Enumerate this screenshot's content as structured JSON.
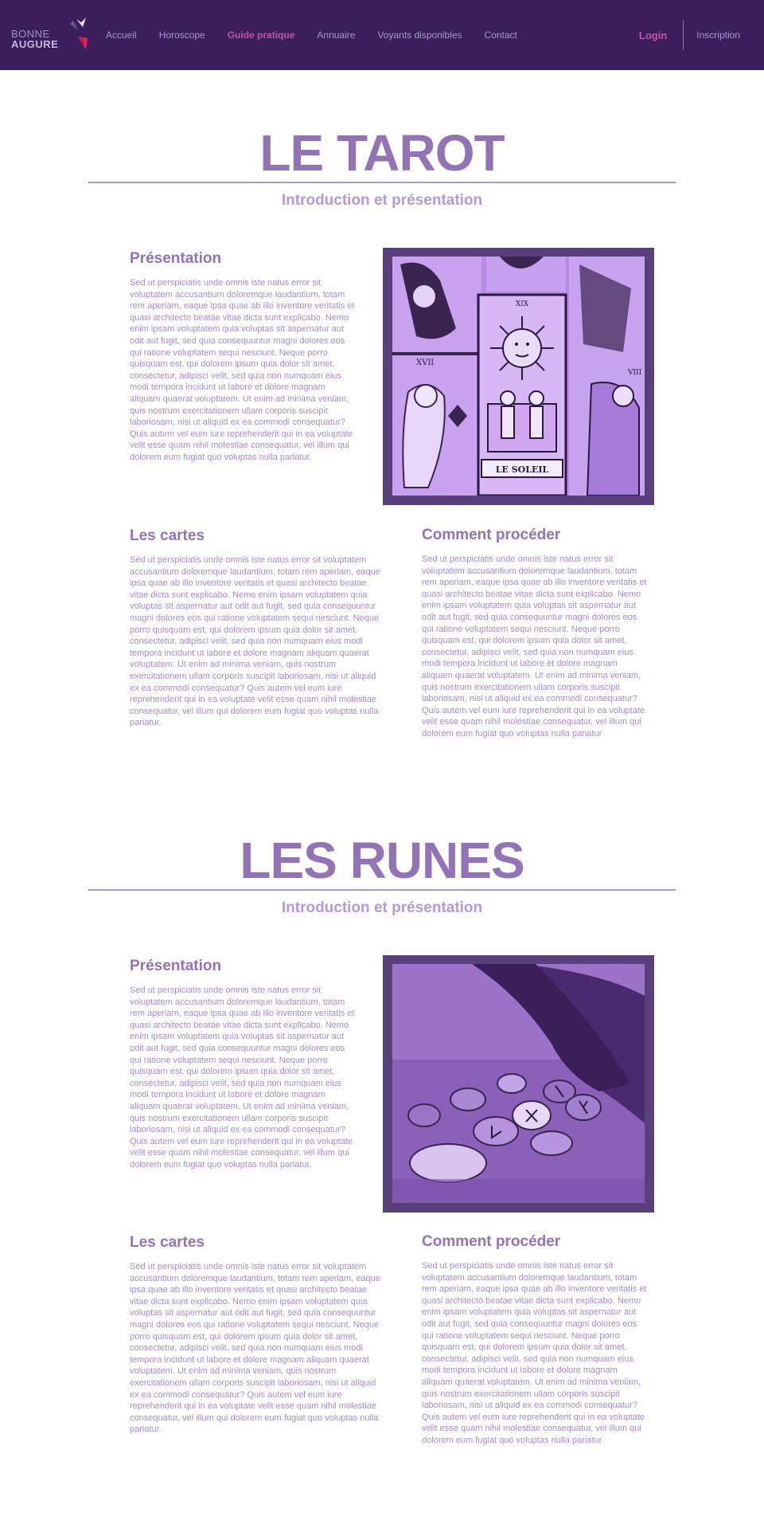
{
  "logo": {
    "line1": "BONNE",
    "line2": "AUGURE"
  },
  "nav": {
    "items": [
      "Accueil",
      "Horoscope",
      "Guide pratique",
      "Annuaire",
      "Voyants disponibles",
      "Contact"
    ],
    "active": "Guide pratique"
  },
  "auth": {
    "login": "Login",
    "signup": "Inscription"
  },
  "sections": [
    {
      "title": "LE TAROT",
      "subtitle": "Introduction et présentation",
      "presentation": {
        "heading": "Présentation",
        "text": "Sed ut perspiciatis unde omnis iste natus error sit voluptatem accusantium doloremque laudantium, totam rem aperiam, eaque ipsa quae ab illo inventore veritatis et quasi architecto beatae vitae dicta sunt explicabo. Nemo enim ipsam voluptatem quia voluptas sit aspernatur aut odit aut fugit, sed quia consequuntur magni dolores eos qui ratione voluptatem sequi nesciunt. Neque porro quisquam est, qui dolorem ipsum quia dolor sit amet, consectetur, adipisci velit, sed quia non numquam eius modi tempora incidunt ut labore et dolore magnam aliquam quaerat voluptatem. Ut enim ad minima veniam, quis nostrum exercitationem ullam corporis suscipit laboriosam, nisi ut aliquid ex ea commodi consequatur? Quis autem vel eum iure reprehenderit qui in ea voluptate velit esse quam nihil molestiae consequatur, vel illum qui dolorem eum fugiat quo voluptas nulla pariatur."
      },
      "image": {
        "label": "LE SOLEIL",
        "numeral_top": "XIX",
        "numeral_left": "XVII",
        "numeral_right": "VIII"
      },
      "cards": {
        "heading": "Les cartes",
        "text": "Sed ut perspiciatis unde omnis iste natus error sit voluptatem accusantium doloremque laudantium, totam rem aperiam, eaque ipsa quae ab illo inventore veritatis et quasi architecto beatae vitae dicta sunt explicabo. Nemo enim ipsam voluptatem quia voluptas sit aspernatur aut odit aut fugit, sed quia consequuntur magni dolores eos qui ratione voluptatem sequi nesciunt. Neque porro quisquam est, qui dolorem ipsum quia dolor sit amet, consectetur, adipisci velit, sed quia non numquam eius modi tempora incidunt ut labore et dolore magnam aliquam quaerat voluptatem. Ut enim ad minima veniam, quis nostrum exercitationem ullam corporis suscipit laboriosam, nisi ut aliquid ex ea commodi consequatur? Quis autem vel eum iure reprehenderit qui in ea voluptate velit esse quam nihil molestiae consequatur, vel illum qui dolorem eum fugiat quo voluptas nulla pariatur."
      },
      "procedure": {
        "heading": "Comment procéder",
        "text": "Sed ut perspiciatis unde omnis iste natus error sit voluptatem accusantium doloremque laudantium, totam rem aperiam, eaque ipsa quae ab illo inventore veritatis et quasi architecto beatae vitae dicta sunt explicabo. Nemo enim ipsam voluptatem quia voluptas sit aspernatur aut odit aut fugit, sed quia consequuntur magni dolores eos qui ratione voluptatem sequi nesciunt. Neque porro quisquam est, qui dolorem ipsum quia dolor sit amet, consectetur, adipisci velit, sed quia non numquam eius modi tempora incidunt ut labore et dolore magnam aliquam quaerat voluptatem. Ut enim ad minima veniam, quis nostrum exercitationem ullam corporis suscipit laboriosam, nisi ut aliquid ex ea commodi consequatur? Quis autem vel eum iure reprehenderit qui in ea voluptate velit esse quam nihil molestiae consequatur, vel illum qui dolorem eum fugiat quo voluptas nulla pariatur"
      }
    },
    {
      "title": "LES RUNES",
      "subtitle": "Introduction et présentation",
      "presentation": {
        "heading": "Présentation",
        "text": "Sed ut perspiciatis unde omnis iste natus error sit voluptatem accusantium doloremque laudantium, totam rem aperiam, eaque ipsa quae ab illo inventore veritatis et quasi architecto beatae vitae dicta sunt explicabo. Nemo enim ipsam voluptatem quia voluptas sit aspernatur aut odit aut fugit, sed quia consequuntur magni dolores eos qui ratione voluptatem sequi nesciunt. Neque porro quisquam est, qui dolorem ipsum quia dolor sit amet, consectetur, adipisci velit, sed quia non numquam eius modi tempora incidunt ut labore et dolore magnam aliquam quaerat voluptatem. Ut enim ad minima veniam, quis nostrum exercitationem ullam corporis suscipit laboriosam, nisi ut aliquid ex ea commodi consequatur? Quis autem vel eum iure reprehenderit qui in ea voluptate velit esse quam nihil molestiae consequatur, vel illum qui dolorem eum fugiat quo voluptas nulla pariatur."
      },
      "cards": {
        "heading": "Les cartes",
        "text": "Sed ut perspiciatis unde omnis iste natus error sit voluptatem accusantium doloremque laudantium, totam rem aperiam, eaque ipsa quae ab illo inventore veritatis et quasi architecto beatae vitae dicta sunt explicabo. Nemo enim ipsam voluptatem quia voluptas sit aspernatur aut odit aut fugit, sed quia consequuntur magni dolores eos qui ratione voluptatem sequi nesciunt. Neque porro quisquam est, qui dolorem ipsum quia dolor sit amet, consectetur, adipisci velit, sed quia non numquam eius modi tempora incidunt ut labore et dolore magnam aliquam quaerat voluptatem. Ut enim ad minima veniam, quis nostrum exercitationem ullam corporis suscipit laboriosam, nisi ut aliquid ex ea commodi consequatur? Quis autem vel eum iure reprehenderit qui in ea voluptate velit esse quam nihil molestiae consequatur, vel illum qui dolorem eum fugiat quo voluptas nulla pariatur."
      },
      "procedure": {
        "heading": "Comment procéder",
        "text": "Sed ut perspiciatis unde omnis iste natus error sit voluptatem accusantium doloremque laudantium, totam rem aperiam, eaque ipsa quae ab illo inventore veritatis et quasi architecto beatae vitae dicta sunt explicabo. Nemo enim ipsam voluptatem quia voluptas sit aspernatur aut odit aut fugit, sed quia consequuntur magni dolores eos qui ratione voluptatem sequi nesciunt. Neque porro quisquam est, qui dolorem ipsum quia dolor sit amet, consectetur, adipisci velit, sed quia non numquam eius modi tempora incidunt ut labore et dolore magnam aliquam quaerat voluptatem. Ut enim ad minima veniam, quis nostrum exercitationem ullam corporis suscipit laboriosam, nisi ut aliquid ex ea commodi consequatur? Quis autem vel eum iure reprehenderit qui in ea voluptate velit esse quam nihil molestiae consequatur, vel illum qui dolorem eum fugiat quo voluptas nulla pariatur"
      }
    }
  ],
  "colors": {
    "header_bg": "#3b1f5c",
    "accent": "#c056a5",
    "title": "#9273b3",
    "body_text": "#a68cc8",
    "frame": "#5a3f7d"
  }
}
